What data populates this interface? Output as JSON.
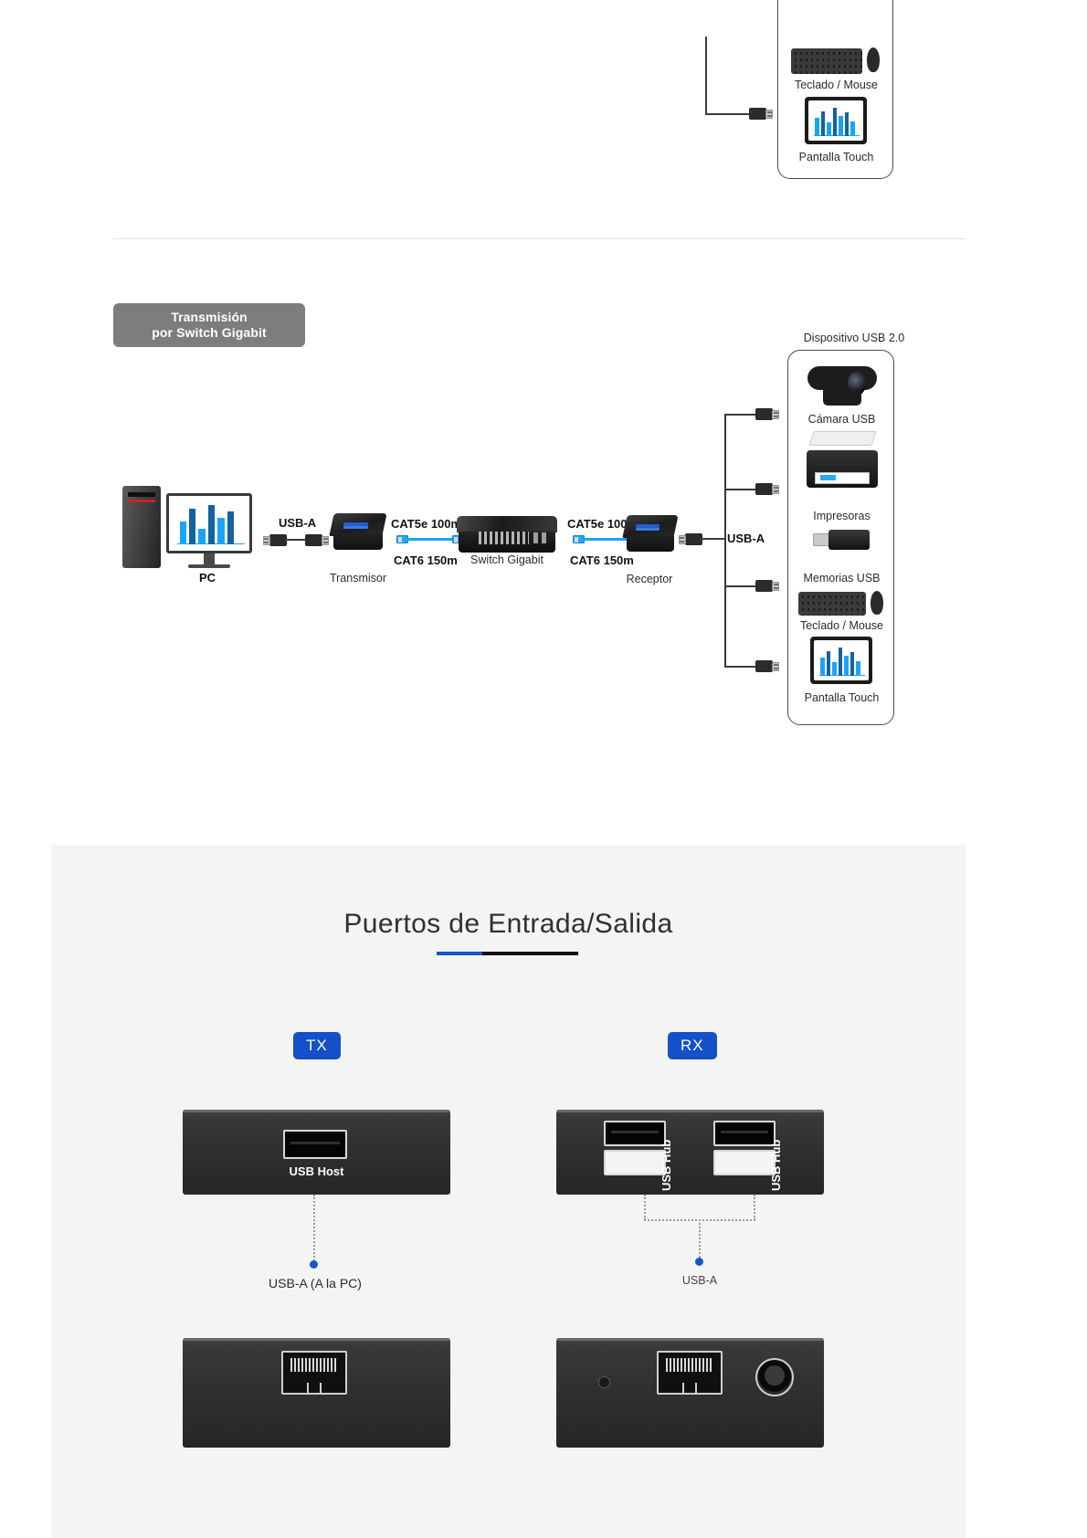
{
  "top_diagram": {
    "devices": [
      {
        "label": "Teclado / Mouse",
        "icon": "keyboard-mouse-icon"
      },
      {
        "label": "Pantalla Touch",
        "icon": "touch-screen-icon"
      }
    ]
  },
  "switch_diagram": {
    "badge": {
      "line1": "Transmisión",
      "line2": "por Switch Gigabit"
    },
    "panel_title": "Dispositivo USB 2.0",
    "nodes": {
      "pc": "PC",
      "transmitter": "Transmisor",
      "switch": "Switch Gigabit",
      "receiver": "Receptor"
    },
    "cables": {
      "usb_left": "USB-A",
      "usb_right": "USB-A",
      "left_cat5e": "CAT5e 100m",
      "left_cat6": "CAT6  150m",
      "right_cat5e": "CAT5e 100m",
      "right_cat6": "CAT6  150m"
    },
    "devices": [
      {
        "label": "Cámara USB",
        "icon": "webcam-icon"
      },
      {
        "label": "Impresoras",
        "icon": "printer-icon"
      },
      {
        "label": "Memorias USB",
        "icon": "usb-flash-drive-icon"
      },
      {
        "label": "Teclado / Mouse",
        "icon": "keyboard-mouse-icon"
      },
      {
        "label": "Pantalla Touch",
        "icon": "touch-screen-icon"
      }
    ]
  },
  "ports_section": {
    "title": "Puertos de Entrada/Salida",
    "accent_blue": "#1457c8",
    "accent_black": "#111111",
    "tx": {
      "badge": "TX",
      "front_port_caption": "USB Host",
      "front_callout": "USB-A (A la PC)"
    },
    "rx": {
      "badge": "RX",
      "port_caption_left": "USB Hub",
      "port_caption_right": "USB Hub",
      "callout": "USB-A"
    }
  }
}
